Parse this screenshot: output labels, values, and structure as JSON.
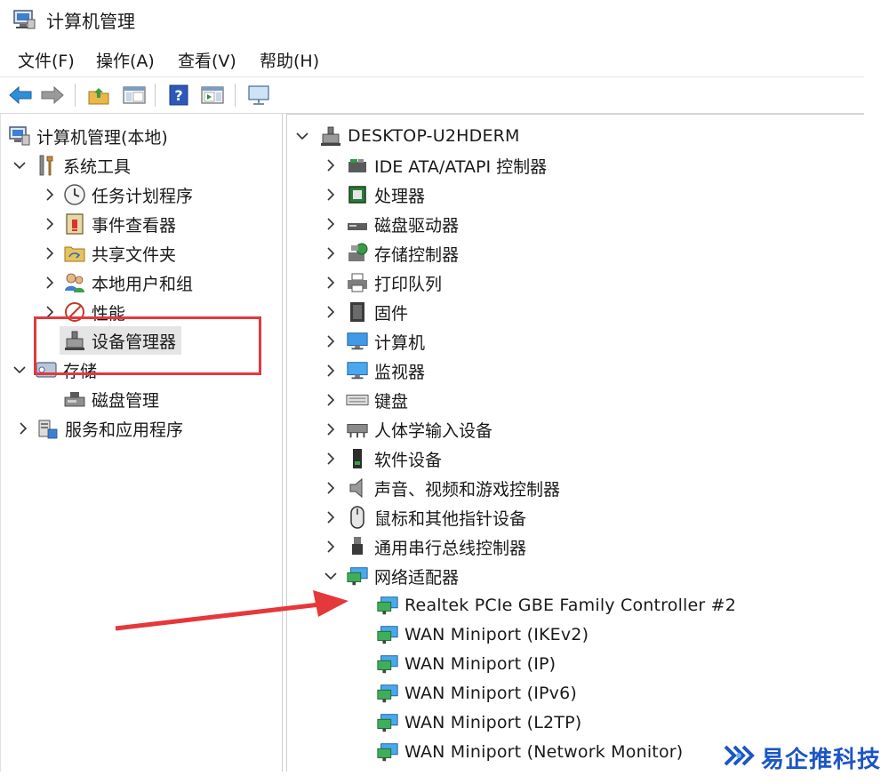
{
  "window": {
    "title": "计算机管理"
  },
  "menu": [
    "文件(F)",
    "操作(A)",
    "查看(V)",
    "帮助(H)"
  ],
  "toolbar": {
    "buttons": [
      "back-arrow-icon",
      "forward-arrow-icon",
      "up-folder-icon",
      "console-tree-icon",
      "help-icon",
      "action-pane-icon",
      "monitor-icon"
    ]
  },
  "tree": {
    "root": "计算机管理(本地)",
    "system_tools": "系统工具",
    "task_scheduler": "任务计划程序",
    "event_viewer": "事件查看器",
    "shared_folders": "共享文件夹",
    "local_users": "本地用户和组",
    "performance": "性能",
    "device_manager": "设备管理器",
    "storage": "存储",
    "disk_management": "磁盘管理",
    "services_apps": "服务和应用程序"
  },
  "devices": {
    "computer": "DESKTOP-U2HDERM",
    "categories": [
      "IDE ATA/ATAPI 控制器",
      "处理器",
      "磁盘驱动器",
      "存储控制器",
      "打印队列",
      "固件",
      "计算机",
      "监视器",
      "键盘",
      "人体学输入设备",
      "软件设备",
      "声音、视频和游戏控制器",
      "鼠标和其他指针设备",
      "通用串行总线控制器",
      "网络适配器"
    ],
    "network_adapters": [
      "Realtek PCIe GBE Family Controller #2",
      "WAN Miniport (IKEv2)",
      "WAN Miniport (IP)",
      "WAN Miniport (IPv6)",
      "WAN Miniport (L2TP)",
      "WAN Miniport (Network Monitor)"
    ]
  },
  "watermark": {
    "text": "易企推科技"
  },
  "colors": {
    "highlight": "#e5383b",
    "brand": "#1c56c4",
    "selection": "#e5e5e5"
  }
}
